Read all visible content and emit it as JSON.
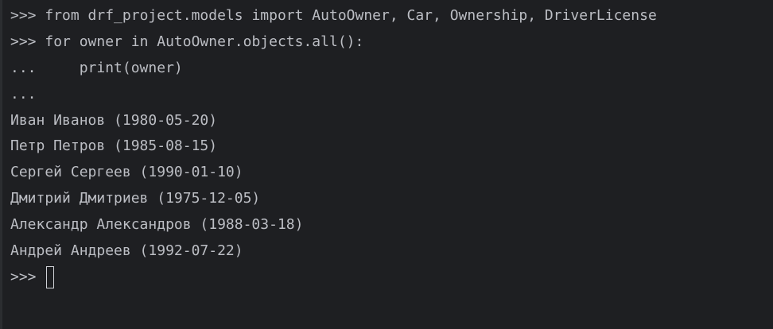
{
  "console": {
    "lines": [
      {
        "prompt": ">>> ",
        "text": "from drf_project.models import AutoOwner, Car, Ownership, DriverLicense"
      },
      {
        "prompt": ">>> ",
        "text": "for owner in AutoOwner.objects.all():"
      },
      {
        "prompt": "...     ",
        "text": "print(owner)"
      },
      {
        "prompt": "...",
        "text": ""
      }
    ],
    "output": [
      "Иван Иванов (1980-05-20)",
      "Петр Петров (1985-08-15)",
      "Сергей Сергеев (1990-01-10)",
      "Дмитрий Дмитриев (1975-12-05)",
      "Александр Александров (1988-03-18)",
      "Андрей Андреев (1992-07-22)"
    ],
    "active_prompt": ">>> ",
    "input_value": ""
  },
  "colors": {
    "background": "#1e1f22",
    "text": "#bcbec4",
    "gutter": "#2b2d30"
  }
}
